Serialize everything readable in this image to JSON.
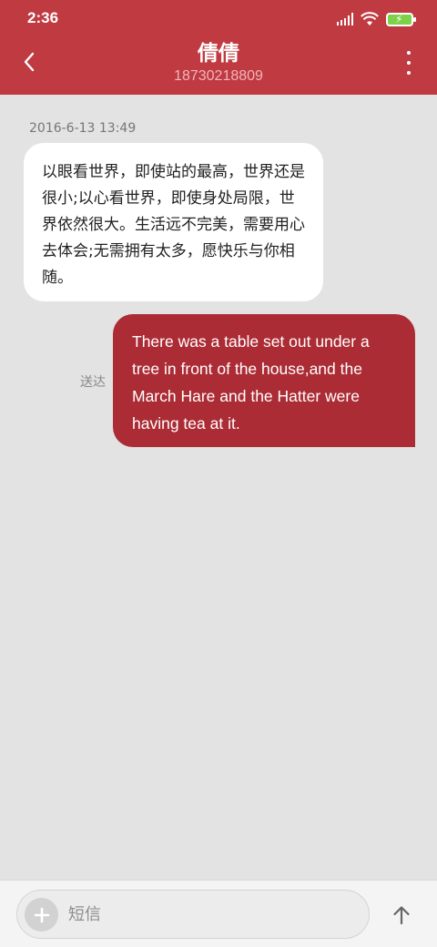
{
  "statusbar": {
    "time": "2:36"
  },
  "header": {
    "contact_name": "倩倩",
    "contact_number": "18730218809"
  },
  "conversation": {
    "timestamp": "2016-6-13 13:49",
    "messages": [
      {
        "direction": "incoming",
        "text": "以眼看世界，即使站的最高，世界还是很小;以心看世界，即使身处局限，世界依然很大。生活远不完美，需要用心去体会;无需拥有太多，愿快乐与你相随。"
      },
      {
        "direction": "outgoing",
        "text": "There was a table set out under a tree in front of the house,and the March Hare and the Hatter were having tea at it.",
        "status": "送达"
      }
    ]
  },
  "composer": {
    "placeholder": "短信"
  },
  "colors": {
    "header_bg": "#c03a42",
    "outgoing_bubble": "#ac2c35",
    "incoming_bubble": "#ffffff",
    "background": "#e3e3e3",
    "battery": "#7ed24a"
  }
}
